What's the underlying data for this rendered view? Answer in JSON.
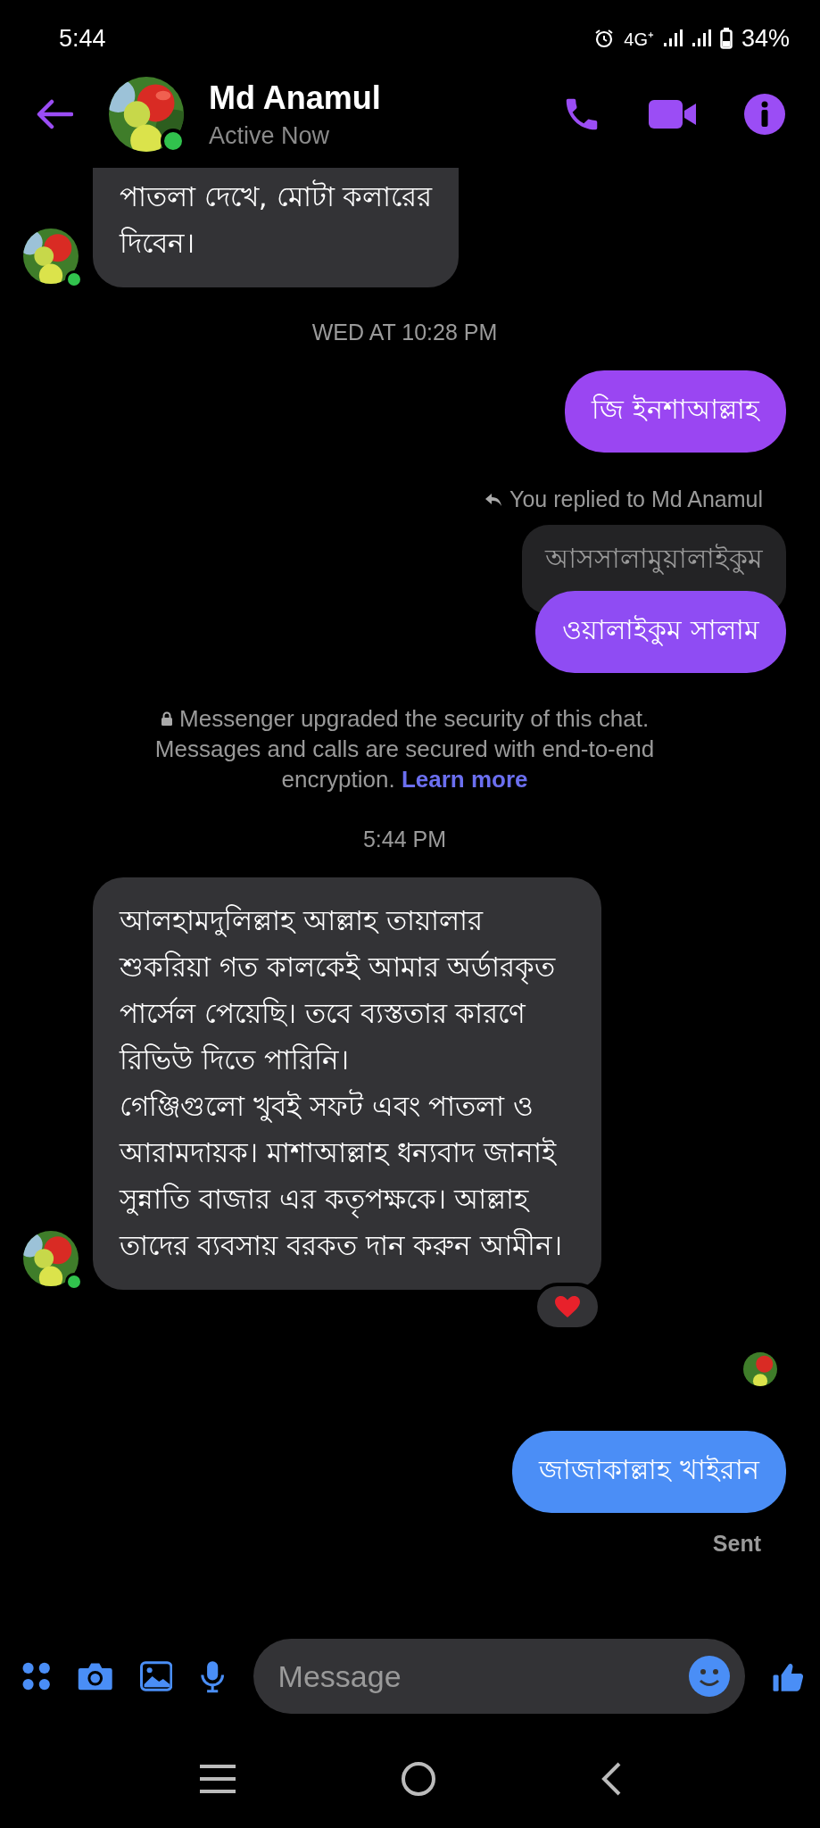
{
  "status_bar": {
    "time": "5:44",
    "network": "4G⁺",
    "battery": "34%"
  },
  "contact": {
    "name": "Md Anamul",
    "status": "Active Now",
    "online": true
  },
  "messages": [
    {
      "kind": "received",
      "text": "পাতলা দেখে, মোটা কলারের\nদিবেন।",
      "avatar": true,
      "reacted": false
    },
    {
      "kind": "timestamp",
      "text": "WED AT 10:28 PM"
    },
    {
      "kind": "sent",
      "text": "জি ইনশাআল্লাহ",
      "color": "#9a46f2"
    },
    {
      "kind": "reply",
      "label": "You replied to Md Anamul",
      "quoted": "আসসালামুয়ালাইকুম",
      "text": "ওয়ালাইকুম সালাম",
      "color": "#8f4cf3"
    },
    {
      "kind": "notice",
      "text": "Messenger upgraded the security of this chat. Messages and calls are secured with end-to-end encryption.",
      "link": "Learn more"
    },
    {
      "kind": "timestamp",
      "text": "5:44 PM"
    },
    {
      "kind": "received",
      "text": "আলহামদুলিল্লাহ আল্লাহ তায়ালার শুকরিয়া গত কালকেই আমার অর্ডারকৃত পার্সেল পেয়েছি। তবে ব্যস্ততার কারণে রিভিউ দিতে পারিনি।\nগেঞ্জিগুলো খুবই সফট এবং পাতলা ও আরামদায়ক। মাশাআল্লাহ ধন্যবাদ জানাই সুন্নাতি বাজার এর কতৃপক্ষকে। আল্লাহ তাদের ব্যবসায় বরকত দান করুন আমীন।",
      "avatar": true,
      "reacted": true
    },
    {
      "kind": "seen"
    },
    {
      "kind": "sent",
      "text": "জাজাকাল্লাহ খাইরান",
      "color": "#4b8ef6"
    },
    {
      "kind": "status",
      "text": "Sent"
    }
  ],
  "composer": {
    "placeholder": "Message"
  }
}
